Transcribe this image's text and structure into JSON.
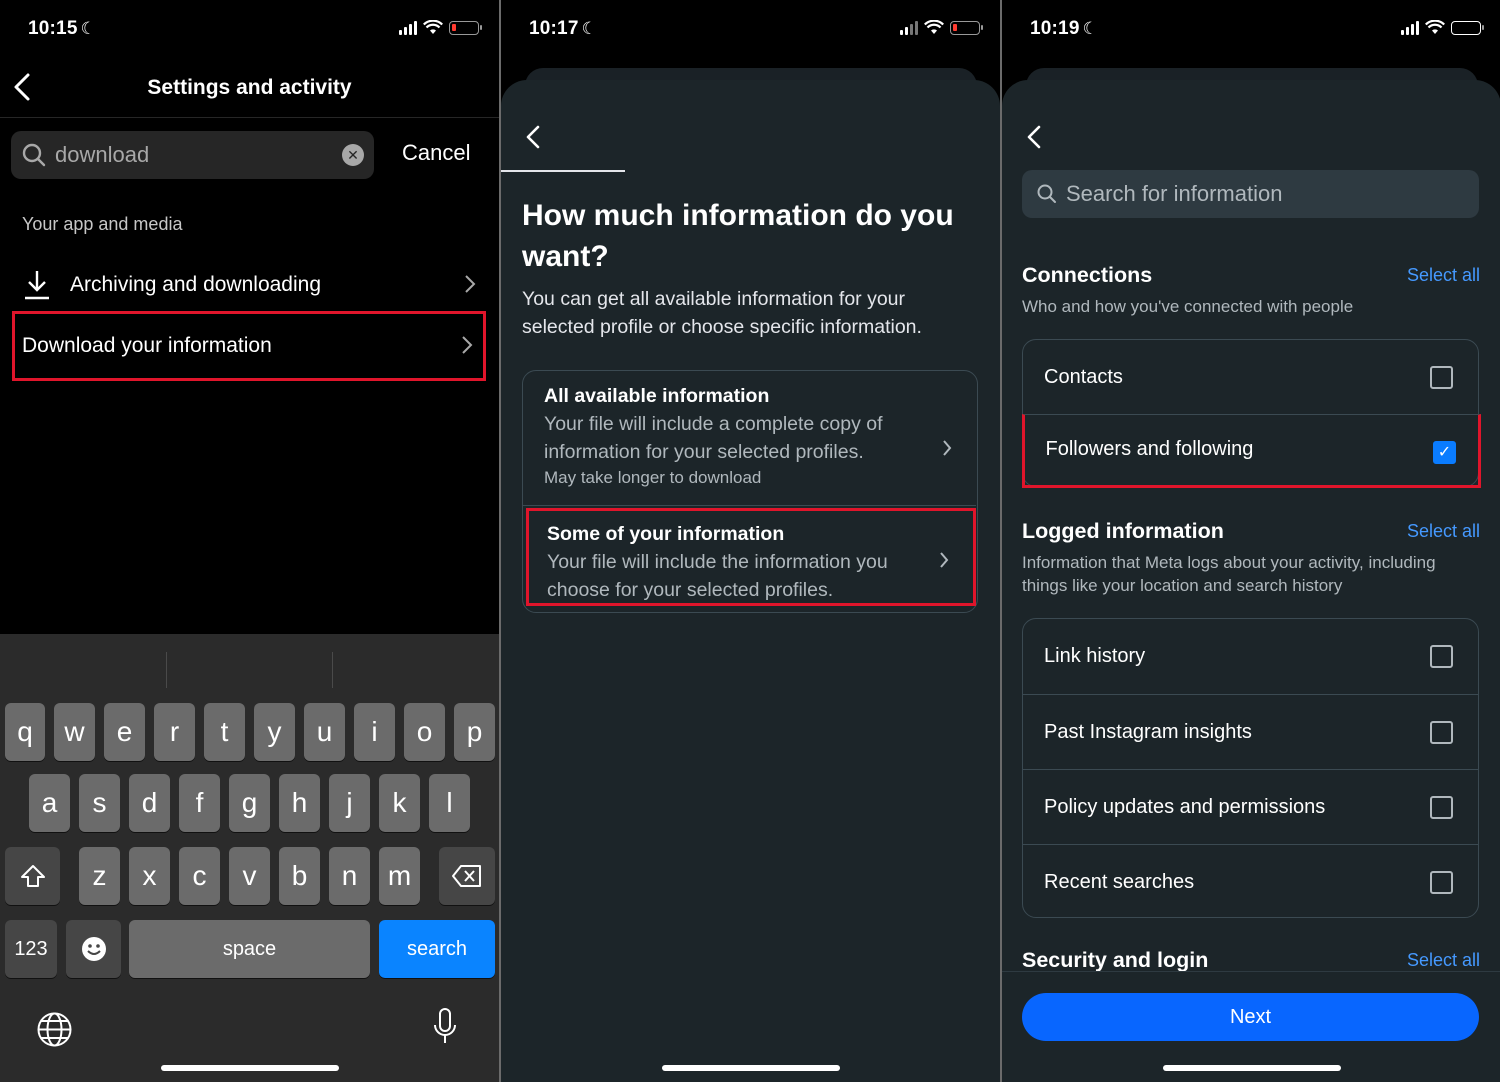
{
  "panel1": {
    "status": {
      "time": "10:15"
    },
    "title": "Settings and activity",
    "search": {
      "value": "download",
      "cancel_label": "Cancel"
    },
    "section_label": "Your app and media",
    "items": [
      {
        "label": "Archiving and downloading"
      },
      {
        "label": "Download your information"
      }
    ],
    "keyboard": {
      "row1": [
        "q",
        "w",
        "e",
        "r",
        "t",
        "y",
        "u",
        "i",
        "o",
        "p"
      ],
      "row2": [
        "a",
        "s",
        "d",
        "f",
        "g",
        "h",
        "j",
        "k",
        "l"
      ],
      "row3": [
        "z",
        "x",
        "c",
        "v",
        "b",
        "n",
        "m"
      ],
      "numbers_label": "123",
      "space_label": "space",
      "search_label": "search"
    }
  },
  "panel2": {
    "status": {
      "time": "10:17"
    },
    "heading": "How much information do you want?",
    "subtitle": "You can get all available information for your selected profile or choose specific information.",
    "options": [
      {
        "title": "All available information",
        "desc": "Your file will include a complete copy of information for your selected profiles.",
        "note": "May take longer to download"
      },
      {
        "title": "Some of your information",
        "desc": "Your file will include the information you choose for your selected profiles."
      }
    ]
  },
  "panel3": {
    "status": {
      "time": "10:19"
    },
    "search_placeholder": "Search for information",
    "select_all_label": "Select all",
    "connections": {
      "title": "Connections",
      "desc": "Who and how you've connected with people",
      "items": [
        {
          "label": "Contacts",
          "checked": false
        },
        {
          "label": "Followers and following",
          "checked": true
        }
      ]
    },
    "logged": {
      "title": "Logged information",
      "desc": "Information that Meta logs about your activity, including things like your location and search history",
      "items": [
        {
          "label": "Link history",
          "checked": false
        },
        {
          "label": "Past Instagram insights",
          "checked": false
        },
        {
          "label": "Policy updates and permissions",
          "checked": false
        },
        {
          "label": "Recent searches",
          "checked": false
        }
      ]
    },
    "security": {
      "title": "Security and login"
    },
    "next_label": "Next"
  },
  "colors": {
    "accent_blue": "#0866ff",
    "highlight_red": "#e0152b",
    "sheet_bg": "#1c2529"
  }
}
